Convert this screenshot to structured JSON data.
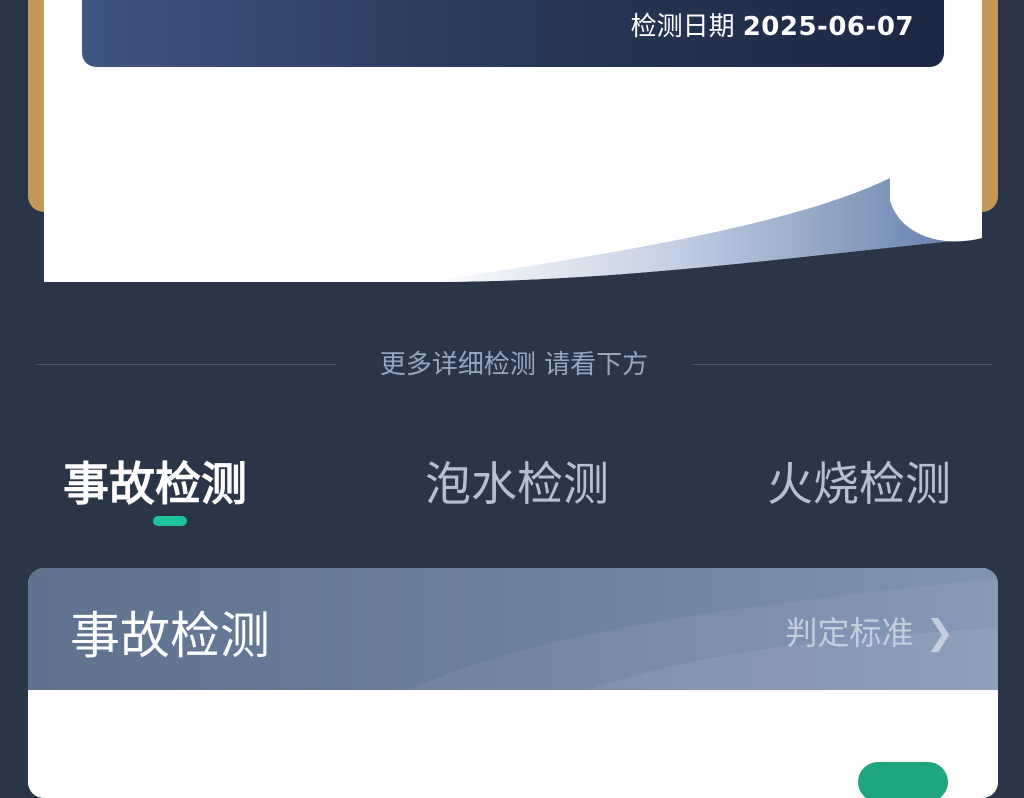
{
  "report": {
    "date_label": "检测日期",
    "date_value": "2025-06-07"
  },
  "divider": {
    "text": "更多详细检测 请看下方"
  },
  "tabs": [
    {
      "label": "事故检测",
      "active": true
    },
    {
      "label": "泡水检测",
      "active": false
    },
    {
      "label": "火烧检测",
      "active": false
    }
  ],
  "section": {
    "title": "事故检测",
    "criteria_label": "判定标准",
    "chevron_icon": "chevron-right-icon"
  },
  "colors": {
    "background": "#2a3548",
    "accent": "#1fc29b",
    "gold": "#c39858"
  }
}
